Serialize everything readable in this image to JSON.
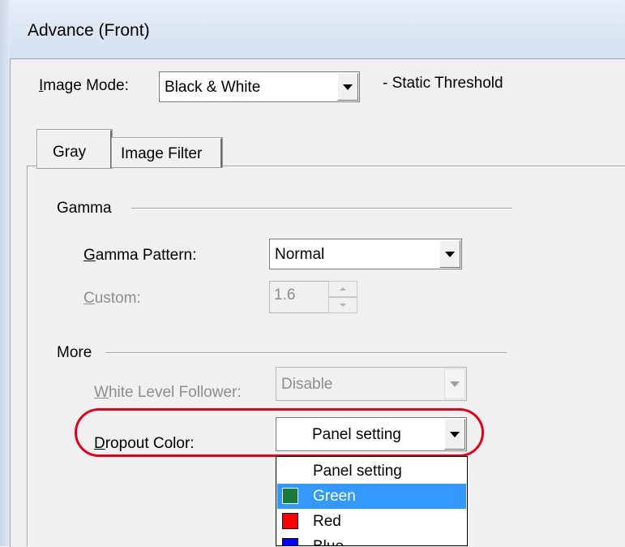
{
  "window": {
    "title": "Advance (Front)"
  },
  "image_mode": {
    "label": "Image Mode:",
    "value": "Black & White",
    "note": "- Static Threshold"
  },
  "tabs": [
    {
      "label": "Gray",
      "active": true
    },
    {
      "label": "Image Filter",
      "active": false
    }
  ],
  "gamma_group": {
    "title": "Gamma",
    "pattern_label": "Gamma Pattern:",
    "pattern_value": "Normal",
    "custom_label": "Custom:",
    "custom_value": "1.6"
  },
  "more_group": {
    "title": "More",
    "wlf_label": "White Level Follower:",
    "wlf_value": "Disable",
    "dropout_label": "Dropout Color:",
    "dropout_value": "Panel setting"
  },
  "dropout_options": [
    {
      "label": "Panel setting",
      "swatch": null
    },
    {
      "label": "Green",
      "swatch": "#1a7a3c",
      "selected": true
    },
    {
      "label": "Red",
      "swatch": "#ff0000"
    },
    {
      "label": "Blue",
      "swatch": "#0000ff"
    }
  ],
  "highlight_color": "#e0001b"
}
